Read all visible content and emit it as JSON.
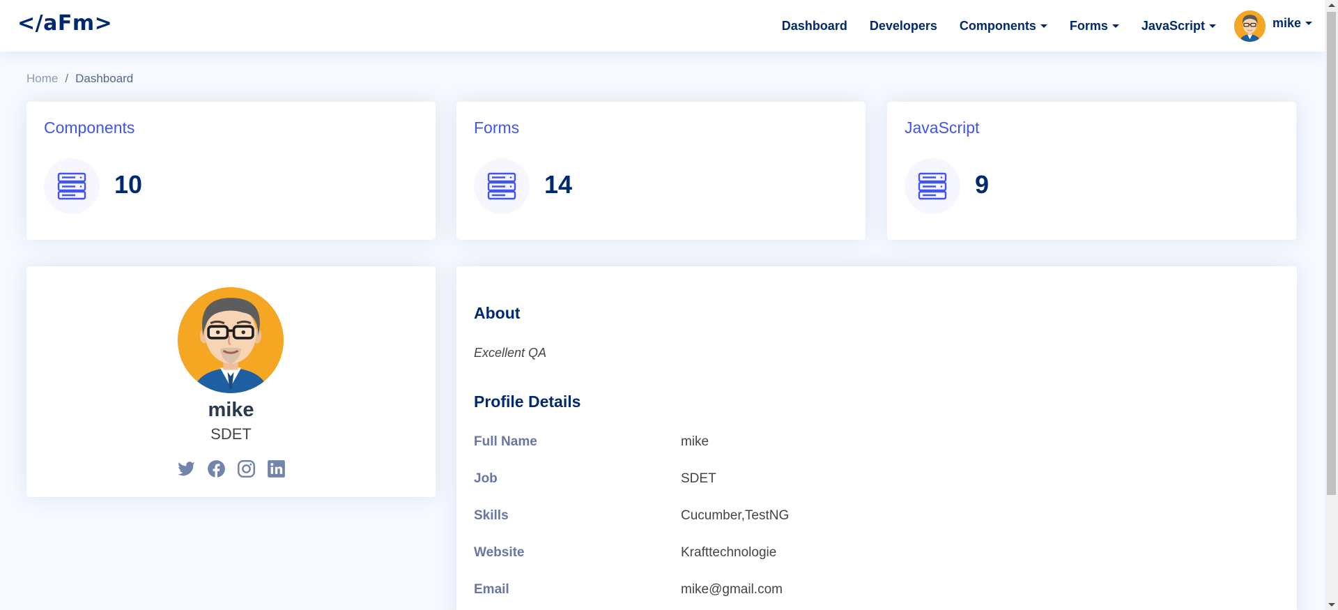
{
  "header": {
    "logo": "</aFm>",
    "nav": {
      "dashboard": "Dashboard",
      "developers": "Developers",
      "components": "Components",
      "forms": "Forms",
      "javascript": "JavaScript",
      "user": "mike"
    }
  },
  "breadcrumb": {
    "home": "Home",
    "separator": "/",
    "current": "Dashboard"
  },
  "stats": [
    {
      "title": "Components",
      "value": "10",
      "icon": "server-icon"
    },
    {
      "title": "Forms",
      "value": "14",
      "icon": "server-icon"
    },
    {
      "title": "JavaScript",
      "value": "9",
      "icon": "server-icon"
    }
  ],
  "profile": {
    "name": "mike",
    "job": "SDET",
    "social": [
      "twitter-icon",
      "facebook-icon",
      "instagram-icon",
      "linkedin-icon"
    ]
  },
  "details": {
    "about_title": "About",
    "about_text": "Excellent QA",
    "profile_title": "Profile Details",
    "rows": [
      {
        "label": "Full Name",
        "value": "mike"
      },
      {
        "label": "Job",
        "value": "SDET"
      },
      {
        "label": "Skills",
        "value": "Cucumber,TestNG"
      },
      {
        "label": "Website",
        "value": "Krafttechnologie"
      },
      {
        "label": "Email",
        "value": "mike@gmail.com"
      }
    ]
  },
  "colors": {
    "primary": "#4154f1",
    "navy": "#012970",
    "muted": "#899bbd",
    "background": "#f6f9ff"
  }
}
